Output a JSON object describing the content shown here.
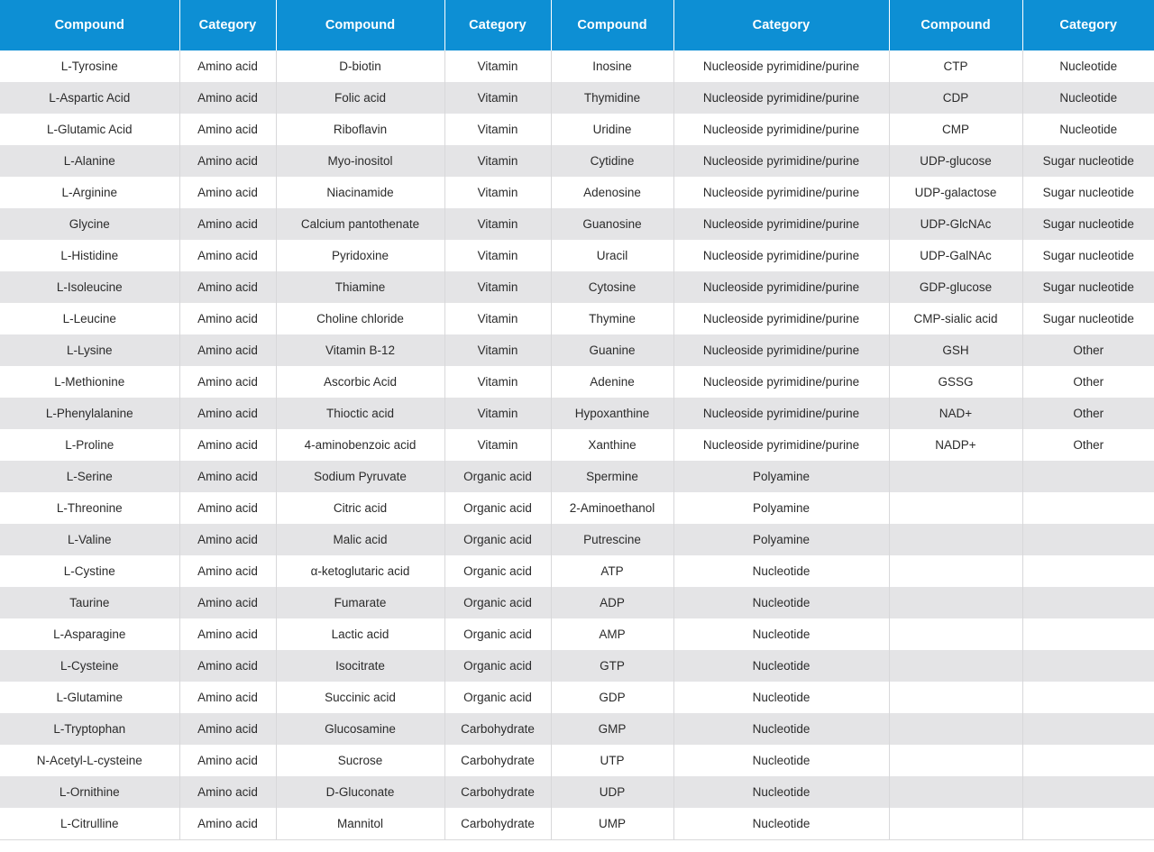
{
  "colors": {
    "header_background": "#0d8fd4",
    "header_text": "#ffffff",
    "row_odd_background": "#ffffff",
    "row_even_background": "#e4e4e6",
    "cell_text": "#2b2b2b",
    "grid_line": "#d8d8da"
  },
  "table": {
    "headers": [
      "Compound",
      "Category",
      "Compound",
      "Category",
      "Compound",
      "Category",
      "Compound",
      "Category"
    ],
    "rows": [
      [
        "L-Tyrosine",
        "Amino acid",
        "D-biotin",
        "Vitamin",
        "Inosine",
        "Nucleoside pyrimidine/purine",
        "CTP",
        "Nucleotide"
      ],
      [
        "L-Aspartic Acid",
        "Amino acid",
        "Folic acid",
        "Vitamin",
        "Thymidine",
        "Nucleoside pyrimidine/purine",
        "CDP",
        "Nucleotide"
      ],
      [
        "L-Glutamic Acid",
        "Amino acid",
        "Riboflavin",
        "Vitamin",
        "Uridine",
        "Nucleoside pyrimidine/purine",
        "CMP",
        "Nucleotide"
      ],
      [
        "L-Alanine",
        "Amino acid",
        "Myo-inositol",
        "Vitamin",
        "Cytidine",
        "Nucleoside pyrimidine/purine",
        "UDP-glucose",
        "Sugar nucleotide"
      ],
      [
        "L-Arginine",
        "Amino acid",
        "Niacinamide",
        "Vitamin",
        "Adenosine",
        "Nucleoside pyrimidine/purine",
        "UDP-galactose",
        "Sugar nucleotide"
      ],
      [
        "Glycine",
        "Amino acid",
        "Calcium pantothenate",
        "Vitamin",
        "Guanosine",
        "Nucleoside pyrimidine/purine",
        "UDP-GlcNAc",
        "Sugar nucleotide"
      ],
      [
        "L-Histidine",
        "Amino acid",
        "Pyridoxine",
        "Vitamin",
        "Uracil",
        "Nucleoside pyrimidine/purine",
        "UDP-GalNAc",
        "Sugar nucleotide"
      ],
      [
        "L-Isoleucine",
        "Amino acid",
        "Thiamine",
        "Vitamin",
        "Cytosine",
        "Nucleoside pyrimidine/purine",
        "GDP-glucose",
        "Sugar nucleotide"
      ],
      [
        "L-Leucine",
        "Amino acid",
        "Choline chloride",
        "Vitamin",
        "Thymine",
        "Nucleoside pyrimidine/purine",
        "CMP-sialic acid",
        "Sugar nucleotide"
      ],
      [
        "L-Lysine",
        "Amino acid",
        "Vitamin B-12",
        "Vitamin",
        "Guanine",
        "Nucleoside pyrimidine/purine",
        "GSH",
        "Other"
      ],
      [
        "L-Methionine",
        "Amino acid",
        "Ascorbic Acid",
        "Vitamin",
        "Adenine",
        "Nucleoside pyrimidine/purine",
        "GSSG",
        "Other"
      ],
      [
        "L-Phenylalanine",
        "Amino acid",
        "Thioctic acid",
        "Vitamin",
        "Hypoxanthine",
        "Nucleoside pyrimidine/purine",
        "NAD+",
        "Other"
      ],
      [
        "L-Proline",
        "Amino acid",
        "4-aminobenzoic acid",
        "Vitamin",
        "Xanthine",
        "Nucleoside pyrimidine/purine",
        "NADP+",
        "Other"
      ],
      [
        "L-Serine",
        "Amino acid",
        "Sodium Pyruvate",
        "Organic acid",
        "Spermine",
        "Polyamine",
        "",
        ""
      ],
      [
        "L-Threonine",
        "Amino acid",
        "Citric acid",
        "Organic acid",
        "2-Aminoethanol",
        "Polyamine",
        "",
        ""
      ],
      [
        "L-Valine",
        "Amino acid",
        "Malic acid",
        "Organic acid",
        "Putrescine",
        "Polyamine",
        "",
        ""
      ],
      [
        "L-Cystine",
        "Amino acid",
        "α-ketoglutaric acid",
        "Organic acid",
        "ATP",
        "Nucleotide",
        "",
        ""
      ],
      [
        "Taurine",
        "Amino acid",
        "Fumarate",
        "Organic acid",
        "ADP",
        "Nucleotide",
        "",
        ""
      ],
      [
        "L-Asparagine",
        "Amino acid",
        "Lactic acid",
        "Organic acid",
        "AMP",
        "Nucleotide",
        "",
        ""
      ],
      [
        "L-Cysteine",
        "Amino acid",
        "Isocitrate",
        "Organic acid",
        "GTP",
        "Nucleotide",
        "",
        ""
      ],
      [
        "L-Glutamine",
        "Amino acid",
        "Succinic acid",
        "Organic acid",
        "GDP",
        "Nucleotide",
        "",
        ""
      ],
      [
        "L-Tryptophan",
        "Amino acid",
        "Glucosamine",
        "Carbohydrate",
        "GMP",
        "Nucleotide",
        "",
        ""
      ],
      [
        "N-Acetyl-L-cysteine",
        "Amino acid",
        "Sucrose",
        "Carbohydrate",
        "UTP",
        "Nucleotide",
        "",
        ""
      ],
      [
        "L-Ornithine",
        "Amino acid",
        "D-Gluconate",
        "Carbohydrate",
        "UDP",
        "Nucleotide",
        "",
        ""
      ],
      [
        "L-Citrulline",
        "Amino acid",
        "Mannitol",
        "Carbohydrate",
        "UMP",
        "Nucleotide",
        "",
        ""
      ]
    ]
  }
}
